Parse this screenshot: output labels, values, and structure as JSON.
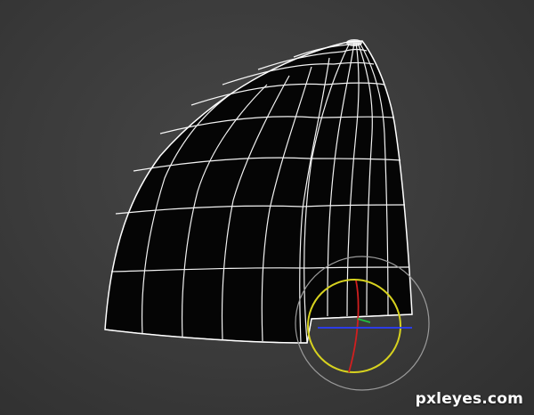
{
  "viewport": {
    "background_color": "#3a3a3a",
    "wireframe_color": "#ffffff",
    "mesh_fill_color": "#050505"
  },
  "gizmo": {
    "type": "rotate-gizmo",
    "outer_ring_color": "#9a9a9a",
    "view_ring_color": "#d7d21f",
    "x_axis_color": "#2a3cff",
    "y_axis_color": "#22c040",
    "z_axis_color": "#d11f1f"
  },
  "watermark": {
    "text": "pxleyes.com"
  }
}
